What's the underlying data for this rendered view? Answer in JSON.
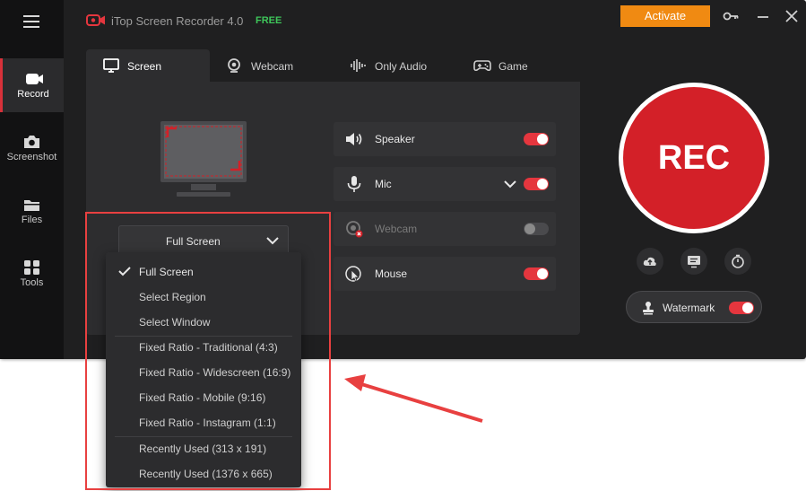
{
  "app": {
    "title": "iTop Screen Recorder 4.0",
    "badge": "FREE",
    "activate_label": "Activate",
    "accent": "#d32028",
    "activate_color": "#f08a12"
  },
  "sidebar": {
    "items": [
      {
        "label": "Record",
        "icon": "record-icon"
      },
      {
        "label": "Screenshot",
        "icon": "camera-icon"
      },
      {
        "label": "Files",
        "icon": "folder-icon"
      },
      {
        "label": "Tools",
        "icon": "tools-icon"
      }
    ]
  },
  "tabs": [
    {
      "label": "Screen",
      "icon": "monitor-icon"
    },
    {
      "label": "Webcam",
      "icon": "webcam-icon"
    },
    {
      "label": "Only Audio",
      "icon": "audio-wave-icon"
    },
    {
      "label": "Game",
      "icon": "gamepad-icon"
    }
  ],
  "mode_select": {
    "value": "Full Screen"
  },
  "dropdown": {
    "items": [
      {
        "label": "Full Screen",
        "selected": true
      },
      {
        "label": "Select Region"
      },
      {
        "label": "Select Window"
      },
      {
        "label": "Fixed Ratio - Traditional (4:3)"
      },
      {
        "label": "Fixed Ratio - Widescreen (16:9)"
      },
      {
        "label": "Fixed Ratio - Mobile (9:16)"
      },
      {
        "label": "Fixed Ratio - Instagram (1:1)"
      },
      {
        "label": "Recently Used (313 x 191)"
      },
      {
        "label": "Recently Used (1376 x 665)"
      }
    ]
  },
  "sources": [
    {
      "label": "Speaker",
      "enabled": true,
      "icon": "speaker-icon"
    },
    {
      "label": "Mic",
      "enabled": true,
      "icon": "mic-icon"
    },
    {
      "label": "Webcam",
      "enabled": false,
      "icon": "webcam-icon"
    },
    {
      "label": "Mouse",
      "enabled": true,
      "icon": "cursor-icon"
    }
  ],
  "rec": {
    "label": "REC"
  },
  "watermark": {
    "label": "Watermark",
    "enabled": true
  }
}
